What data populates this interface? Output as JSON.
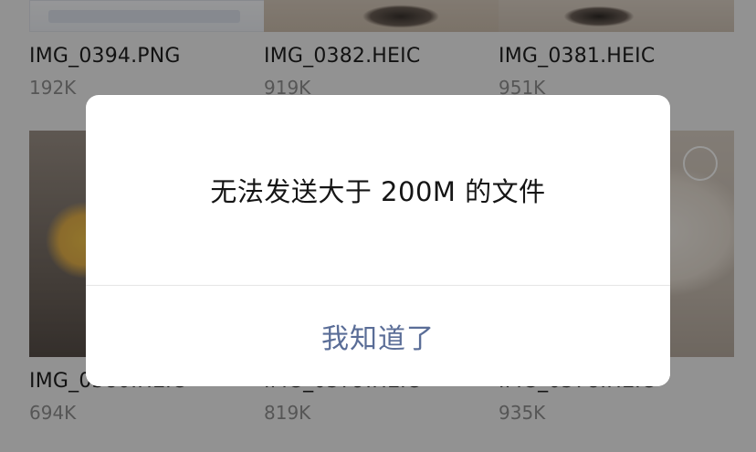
{
  "files": [
    {
      "name": "IMG_0394.PNG",
      "size": "192K"
    },
    {
      "name": "IMG_0382.HEIC",
      "size": "919K"
    },
    {
      "name": "IMG_0381.HEIC",
      "size": "951K"
    },
    {
      "name": "IMG_0380.HEIC",
      "size": "694K"
    },
    {
      "name": "IMG_0379.HEIC",
      "size": "819K"
    },
    {
      "name": "IMG_0378.HEIC",
      "size": "935K"
    }
  ],
  "dialog": {
    "message": "无法发送大于 200M 的文件",
    "confirm_label": "我知道了"
  },
  "colors": {
    "overlay": "rgba(0,0,0,0.40)",
    "button_text": "#5a6d97",
    "dialog_bg": "#ffffff"
  }
}
